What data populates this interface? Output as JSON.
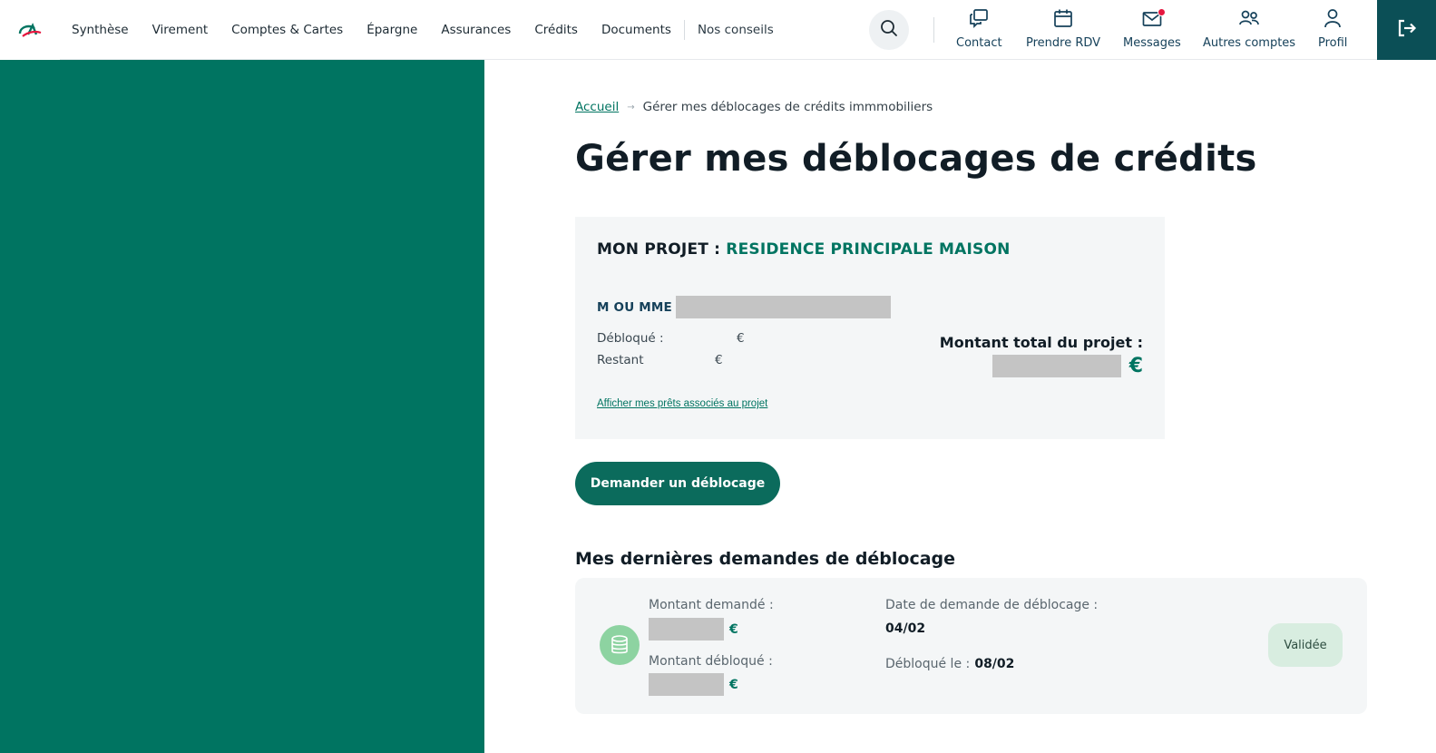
{
  "brand": {
    "logo_text": "CA",
    "accent": "#007461",
    "dark": "#0b4f56",
    "badge_bg": "#d8ede0",
    "icon_bg": "#8dd3a1",
    "notif": "#e5173f"
  },
  "nav": {
    "items": [
      "Synthèse",
      "Virement",
      "Comptes & Cartes",
      "Épargne",
      "Assurances",
      "Crédits",
      "Documents"
    ],
    "extra": "Nos conseils"
  },
  "toolbar": {
    "contact": "Contact",
    "rdv": "Prendre RDV",
    "messages": "Messages",
    "other_accounts": "Autres comptes",
    "profile": "Profil"
  },
  "breadcrumb": {
    "home": "Accueil",
    "current": "Gérer mes déblocages de crédits immmobiliers"
  },
  "page_title": "Gérer mes déblocages de crédits",
  "project": {
    "label": "MON PROJET :",
    "name": "RESIDENCE PRINCIPALE MAISON",
    "holder_label": "M OU MME",
    "released_label": "Débloqué :",
    "remaining_label": "Restant",
    "currency": "€",
    "total_label": "Montant total du projet :",
    "loans_link": "Afficher mes prêts associés au projet"
  },
  "cta_label": "Demander un déblocage",
  "requests": {
    "title": "Mes dernières demandes de déblocage",
    "items": [
      {
        "requested_label": "Montant demandé :",
        "released_label": "Montant débloqué :",
        "date_label": "Date de demande de déblocage :",
        "date_value": "04/02",
        "released_on_label": "Débloqué le :",
        "released_on_value": "08/02",
        "status": "Validée",
        "currency": "€"
      }
    ]
  },
  "icons": {
    "logo": "ca-logo-icon",
    "search": "search-icon",
    "contact": "chat-bubbles-icon",
    "rdv": "calendar-icon",
    "messages": "envelope-icon",
    "other_accounts": "users-icon",
    "profile": "user-icon",
    "logout": "logout-icon",
    "request": "coins-stack-icon"
  }
}
